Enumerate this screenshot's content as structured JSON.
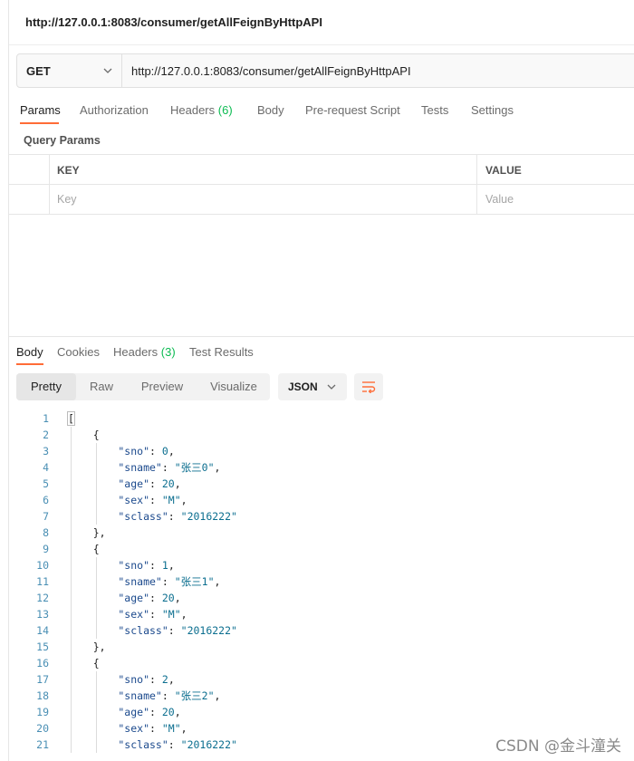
{
  "tab_title": "http://127.0.0.1:8083/consumer/getAllFeignByHttpAPI",
  "request": {
    "method": "GET",
    "url": "http://127.0.0.1:8083/consumer/getAllFeignByHttpAPI"
  },
  "request_tabs": [
    {
      "label": "Params",
      "active": true
    },
    {
      "label": "Authorization"
    },
    {
      "label": "Headers",
      "count": "(6)"
    },
    {
      "label": "Body"
    },
    {
      "label": "Pre-request Script"
    },
    {
      "label": "Tests"
    },
    {
      "label": "Settings"
    }
  ],
  "query_params": {
    "label": "Query Params",
    "columns": [
      "KEY",
      "VALUE"
    ],
    "key_placeholder": "Key",
    "value_placeholder": "Value"
  },
  "response_tabs": [
    {
      "label": "Body",
      "active": true
    },
    {
      "label": "Cookies"
    },
    {
      "label": "Headers",
      "count": "(3)"
    },
    {
      "label": "Test Results"
    }
  ],
  "view_modes": [
    "Pretty",
    "Raw",
    "Preview",
    "Visualize"
  ],
  "active_view": "Pretty",
  "format": "JSON",
  "icons": {
    "method_dropdown": "chevron-down-icon",
    "format_dropdown": "chevron-down-icon",
    "wrap": "wrap-lines-icon"
  },
  "colors": {
    "accent": "#ff6c37",
    "count": "#0cbb52",
    "line_numbers": "#4a8fb4"
  },
  "response_body": {
    "line_numbers": [
      1,
      2,
      3,
      4,
      5,
      6,
      7,
      8,
      9,
      10,
      11,
      12,
      13,
      14,
      15,
      16,
      17,
      18,
      19,
      20,
      21
    ],
    "records": [
      {
        "sno": 0,
        "sname": "张三0",
        "age": 20,
        "sex": "M",
        "sclass": "2016222"
      },
      {
        "sno": 1,
        "sname": "张三1",
        "age": 20,
        "sex": "M",
        "sclass": "2016222"
      },
      {
        "sno": 2,
        "sname": "张三2",
        "age": 20,
        "sex": "M",
        "sclass": "2016222"
      }
    ]
  },
  "watermark": "CSDN @金斗潼关"
}
